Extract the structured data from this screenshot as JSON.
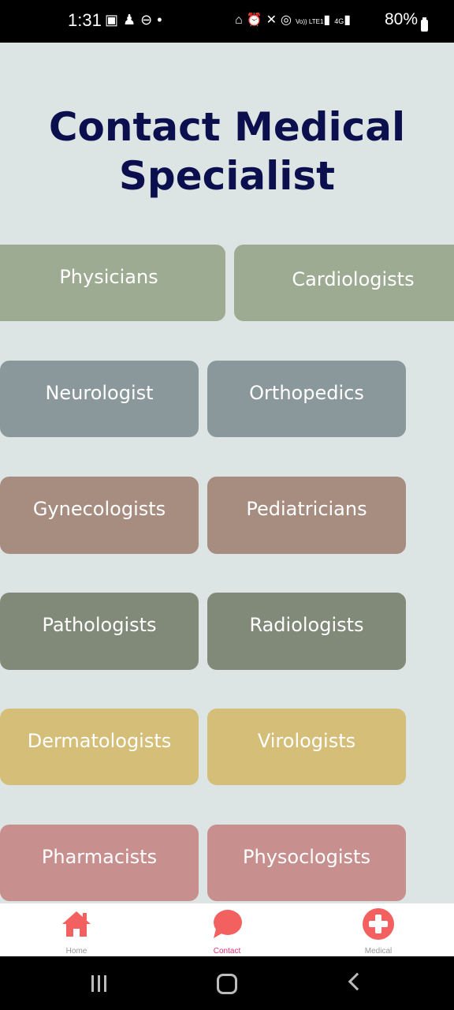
{
  "status_bar": {
    "time": "1:31",
    "left_icons": [
      "image-icon",
      "snapchat-icon",
      "dnd-icon",
      "dot-icon"
    ],
    "right_icons": [
      "battery-saver-icon",
      "alarm-icon",
      "mute-icon",
      "hotspot-icon",
      "volte-icon",
      "signal-icon",
      "4g-icon",
      "signal-icon"
    ],
    "volte_text": "Vo)) LTE1",
    "network_text": "4G",
    "battery": "80%"
  },
  "page": {
    "title_line1": "Contact Medical",
    "title_line2": "Specialist"
  },
  "specialists": [
    {
      "label": "Physicians",
      "color": "#9dab92"
    },
    {
      "label": "Cardiologists",
      "color": "#9dab92"
    },
    {
      "label": "Neurologist",
      "color": "#8a979b"
    },
    {
      "label": "Orthopedics",
      "color": "#8a979b"
    },
    {
      "label": "Gynecologists",
      "color": "#a78c80"
    },
    {
      "label": "Pediatricians",
      "color": "#a78c80"
    },
    {
      "label": "Pathologists",
      "color": "#818a78"
    },
    {
      "label": "Radiologists",
      "color": "#818a78"
    },
    {
      "label": "Dermatologists",
      "color": "#d4be78"
    },
    {
      "label": "Virologists",
      "color": "#d4be78"
    },
    {
      "label": "Pharmacists",
      "color": "#c88f8f"
    },
    {
      "label": "Physoclogists",
      "color": "#c88f8f"
    }
  ],
  "bottom_nav": {
    "items": [
      {
        "label": "Home",
        "icon": "home-icon",
        "active": false
      },
      {
        "label": "Contact",
        "icon": "chat-bubble-icon",
        "active": true
      },
      {
        "label": "Medical",
        "icon": "medical-cross-icon",
        "active": false
      }
    ],
    "icon_color": "#f26060",
    "active_color": "#e0307a"
  }
}
